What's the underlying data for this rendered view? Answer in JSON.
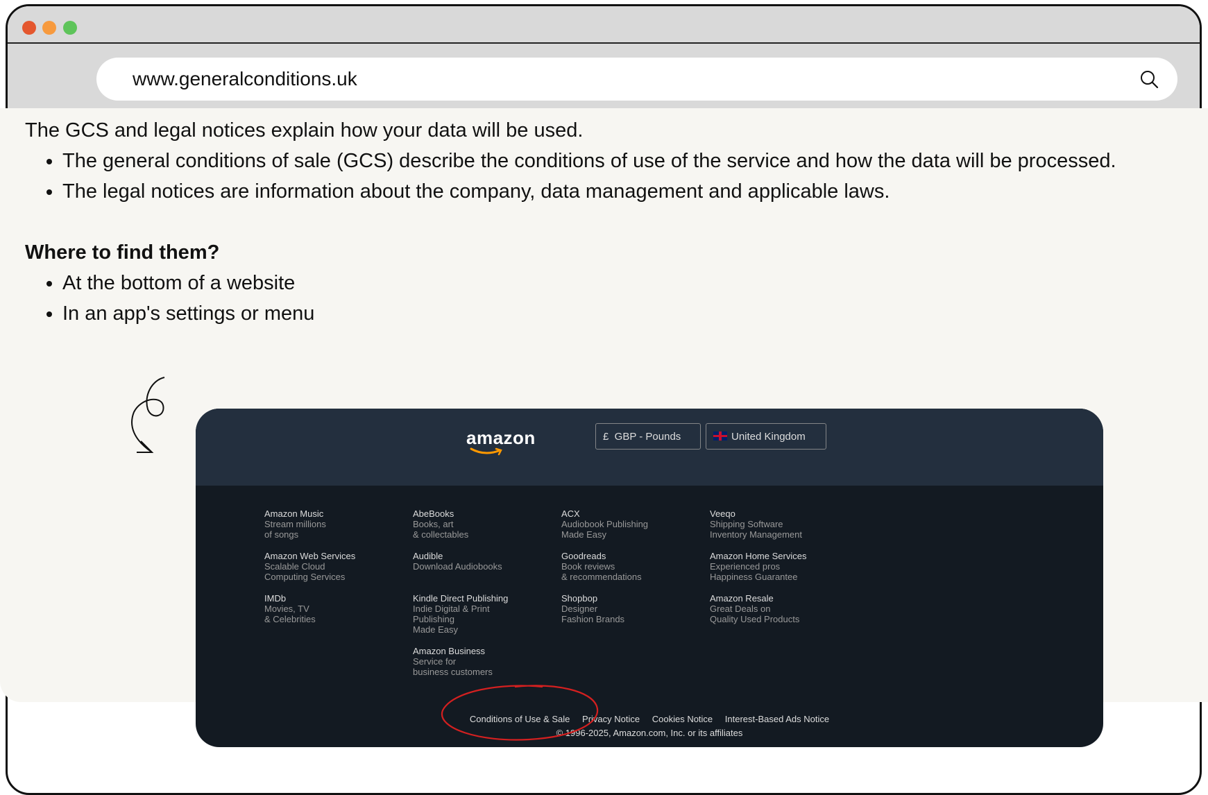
{
  "browser": {
    "url": "www.generalconditions.uk"
  },
  "main": {
    "intro": "The GCS and legal notices explain how your data will be used.",
    "bullets": [
      "The general conditions of sale (GCS) describe the conditions of use of the service and how the data will be processed.",
      "The legal notices are information about the company, data management and applicable laws."
    ],
    "where_heading": "Where to find them?",
    "where_bullets": [
      "At the bottom of a website",
      "In an app's settings or menu"
    ]
  },
  "footer": {
    "logo": "amazon",
    "currency": "£  GBP - Pounds",
    "country": "United Kingdom",
    "columns": [
      [
        {
          "title": "Amazon Music",
          "desc": "Stream millions\nof songs"
        },
        {
          "title": "Amazon Web Services",
          "desc": "Scalable Cloud\nComputing Services"
        },
        {
          "title": "IMDb",
          "desc": "Movies, TV\n& Celebrities"
        }
      ],
      [
        {
          "title": "AbeBooks",
          "desc": "Books, art\n& collectables"
        },
        {
          "title": "Audible",
          "desc": "Download Audiobooks"
        },
        {
          "title": "Kindle Direct Publishing",
          "desc": "Indie Digital & Print\nPublishing\nMade Easy"
        },
        {
          "title": "Amazon Business",
          "desc": "Service for\nbusiness customers"
        }
      ],
      [
        {
          "title": "ACX",
          "desc": "Audiobook Publishing\nMade Easy"
        },
        {
          "title": "Goodreads",
          "desc": "Book reviews\n& recommendations"
        },
        {
          "title": "Shopbop",
          "desc": "Designer\nFashion Brands"
        }
      ],
      [
        {
          "title": "Veeqo",
          "desc": "Shipping Software\nInventory Management"
        },
        {
          "title": "Amazon Home Services",
          "desc": "Experienced pros\nHappiness Guarantee"
        },
        {
          "title": "Amazon Resale",
          "desc": "Great Deals on\nQuality Used Products"
        }
      ]
    ],
    "links": [
      "Conditions of Use & Sale",
      "Privacy Notice",
      "Cookies Notice",
      "Interest-Based Ads Notice"
    ],
    "copyright": "© 1996-2025, Amazon.com, Inc. or its affiliates"
  },
  "colors": {
    "annotation": "#d42020",
    "footer_bg": "#131a22",
    "footer_top_bg": "#232f3e",
    "amazon_smile": "#ff9900"
  }
}
